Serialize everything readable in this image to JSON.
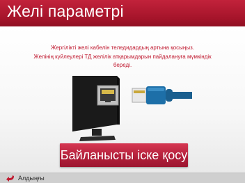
{
  "window": {
    "title": "Желі параметрі"
  },
  "message": {
    "line1": "Жергілікті желі кабелін теледидардың артына қосыңыз.",
    "line2": "Желінің күйлеулері ТД желілік атқарымдарын пайдалануға мүмкіндік",
    "line3": "береді."
  },
  "illustration": {
    "tv_icon": "tv-icon",
    "port_icon": "ethernet-port-icon",
    "cable_icon": "lan-cable-icon"
  },
  "actions": {
    "connect_label": "Байланысты іске қосу"
  },
  "footer": {
    "back_label": "Алдыңғы",
    "back_icon": "back-arrow-icon"
  },
  "colors": {
    "accent": "#b01e39",
    "title_bg": "#a5142a",
    "text_accent": "#c0192f",
    "cable": "#1d6fa8"
  }
}
